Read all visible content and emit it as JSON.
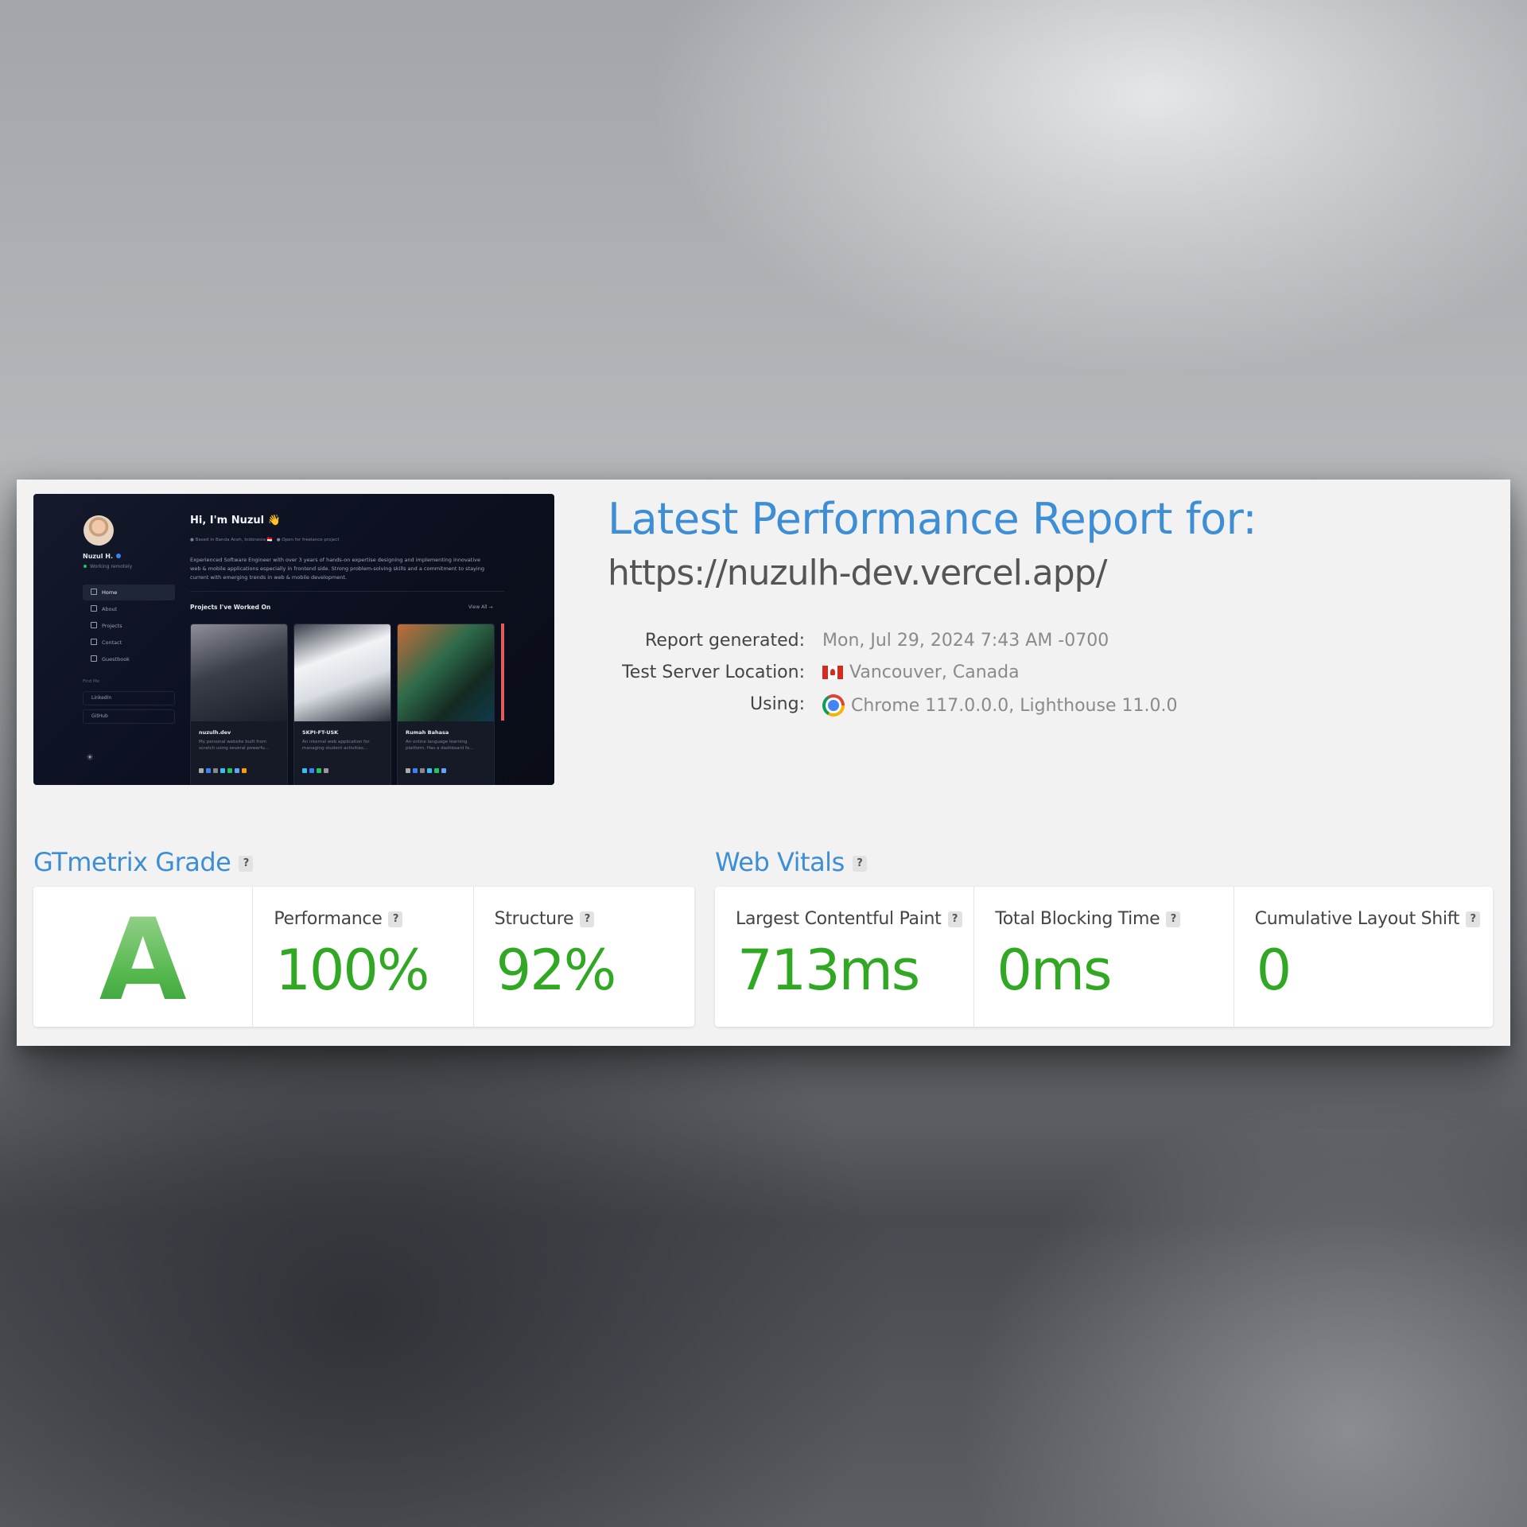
{
  "preview": {
    "profile_name": "Nuzul H.",
    "profile_status": "Working remotely",
    "nav": [
      "Home",
      "About",
      "Projects",
      "Contact",
      "Guestbook"
    ],
    "follow_label": "Find Me",
    "social": [
      "LinkedIn",
      "GitHub"
    ],
    "greeting": "Hi, I'm Nuzul 👋",
    "location": "Based in Banda Aceh, Indonesia 🇮🇩",
    "availability": "Open for freelance project",
    "bio": "Experienced Software Engineer with over 3 years of hands-on expertise designing and implementing innovative web & mobile applications especially in frontend side. Strong problem-solving skills and a commitment to staying current with emerging trends in web & mobile development.",
    "projects_heading": "Projects I've Worked On",
    "view_all": "View All →",
    "projects": [
      {
        "title": "nuzulh.dev",
        "desc": "My personal website built from scratch using several powerfu..."
      },
      {
        "title": "SKPI-FT-USK",
        "desc": "An internal web application for managing student activities..."
      },
      {
        "title": "Rumah Bahasa",
        "desc": "An online language learning platform. Has a dashboard fo..."
      }
    ]
  },
  "report": {
    "title": "Latest Performance Report for:",
    "url": "https://nuzulh-dev.vercel.app/",
    "generated_label": "Report generated:",
    "generated_value": "Mon, Jul 29, 2024 7:43 AM -0700",
    "location_label": "Test Server Location:",
    "location_value": "Vancouver, Canada",
    "using_label": "Using:",
    "using_value": "Chrome 117.0.0.0, Lighthouse 11.0.0"
  },
  "grade": {
    "heading": "GTmetrix Grade",
    "letter": "A",
    "performance_label": "Performance",
    "performance_value": "100%",
    "structure_label": "Structure",
    "structure_value": "92%"
  },
  "vitals": {
    "heading": "Web Vitals",
    "lcp_label": "Largest Contentful Paint",
    "lcp_value": "713ms",
    "tbt_label": "Total Blocking Time",
    "tbt_value": "0ms",
    "cls_label": "Cumulative Layout Shift",
    "cls_value": "0"
  },
  "help_glyph": "?",
  "colors": {
    "accent_blue": "#3d8ed4",
    "good_green": "#31a823",
    "card_bg": "#f2f2f2"
  },
  "icons": [
    "canada-flag-icon",
    "chrome-icon",
    "help-icon"
  ]
}
